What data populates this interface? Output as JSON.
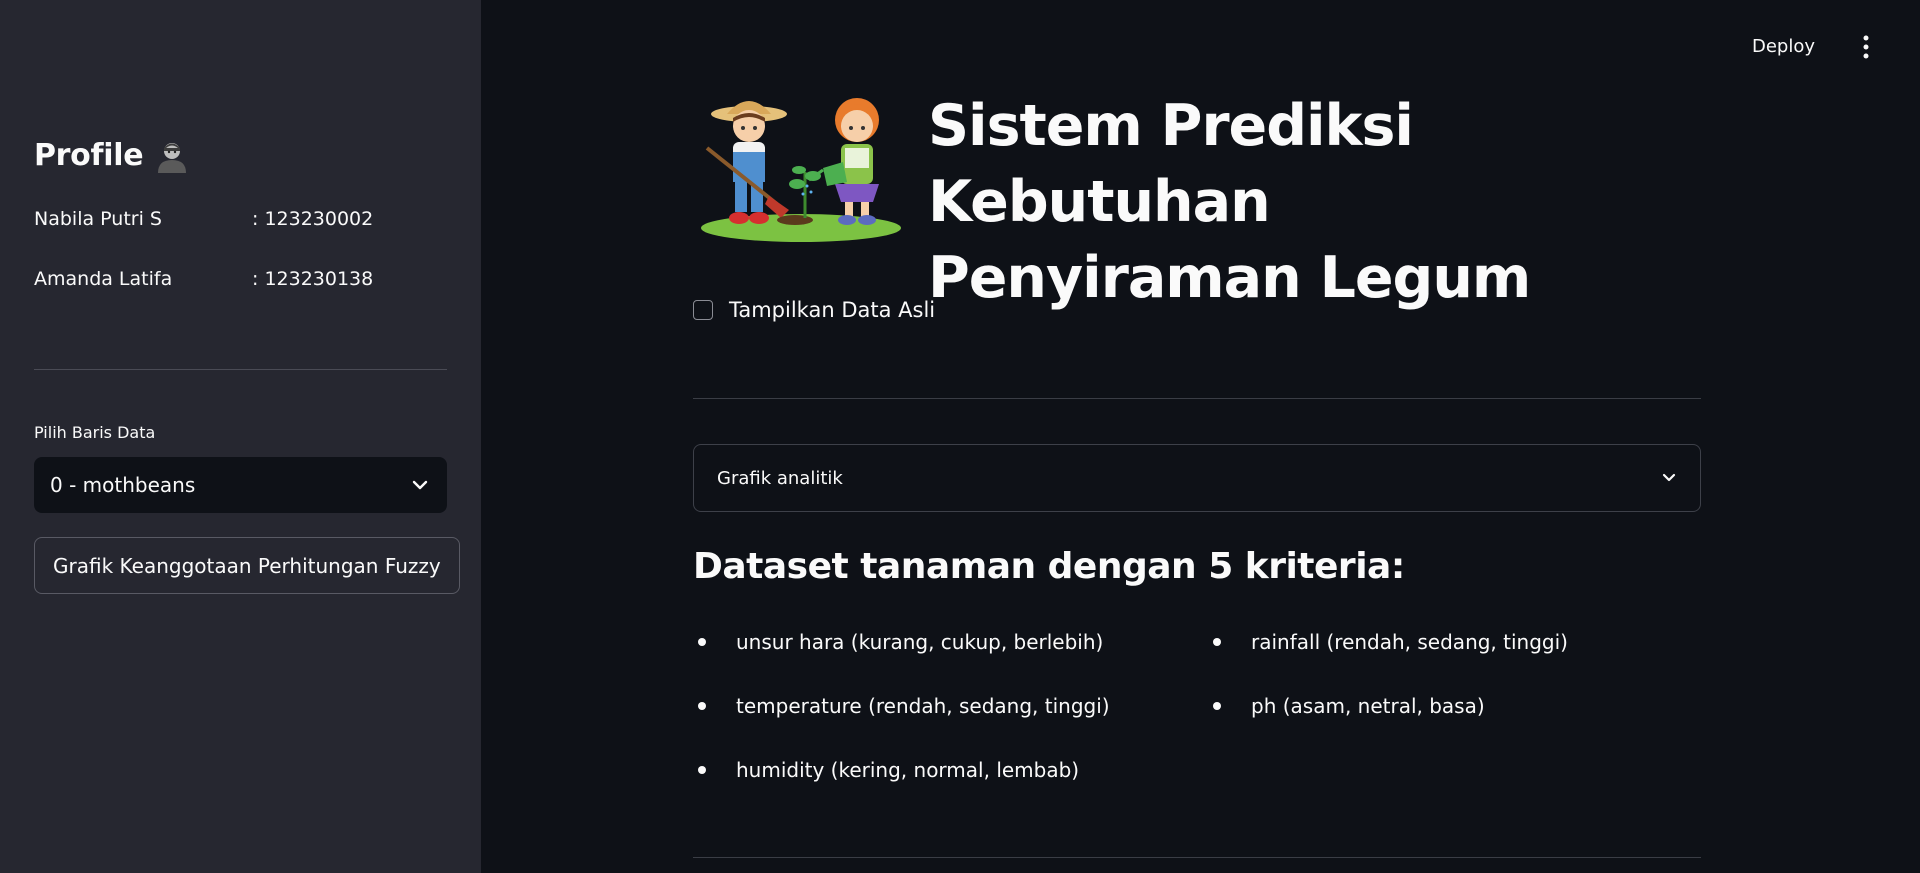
{
  "sidebar": {
    "profile_title": "Profile",
    "members": [
      {
        "name": "Nabila Putri S",
        "id": ": 123230002"
      },
      {
        "name": "Amanda Latifa",
        "id": ": 123230138"
      }
    ],
    "select_label": "Pilih Baris Data",
    "select_value": "0 - mothbeans",
    "fuzzy_button": "Grafik Keanggotaan Perhitungan Fuzzy"
  },
  "header": {
    "deploy": "Deploy"
  },
  "main": {
    "title_line1": "Sistem Prediksi Kebutuhan",
    "title_line2": "Penyiraman Legum",
    "checkbox_label": "Tampilkan Data Asli",
    "checkbox_checked": false,
    "expander_label": "Grafik analitik",
    "dataset_title": "Dataset tanaman dengan 5 kriteria:",
    "criteria_left": [
      "unsur hara (kurang, cukup, berlebih)",
      "temperature (rendah, sedang, tinggi)",
      "humidity (kering, normal, lembab)"
    ],
    "criteria_right": [
      "rainfall (rendah, sedang, tinggi)",
      "ph (asam, netral, basa)"
    ]
  },
  "colors": {
    "sidebar_bg": "#262730",
    "main_bg": "#0e1117",
    "text": "#fafafa"
  }
}
